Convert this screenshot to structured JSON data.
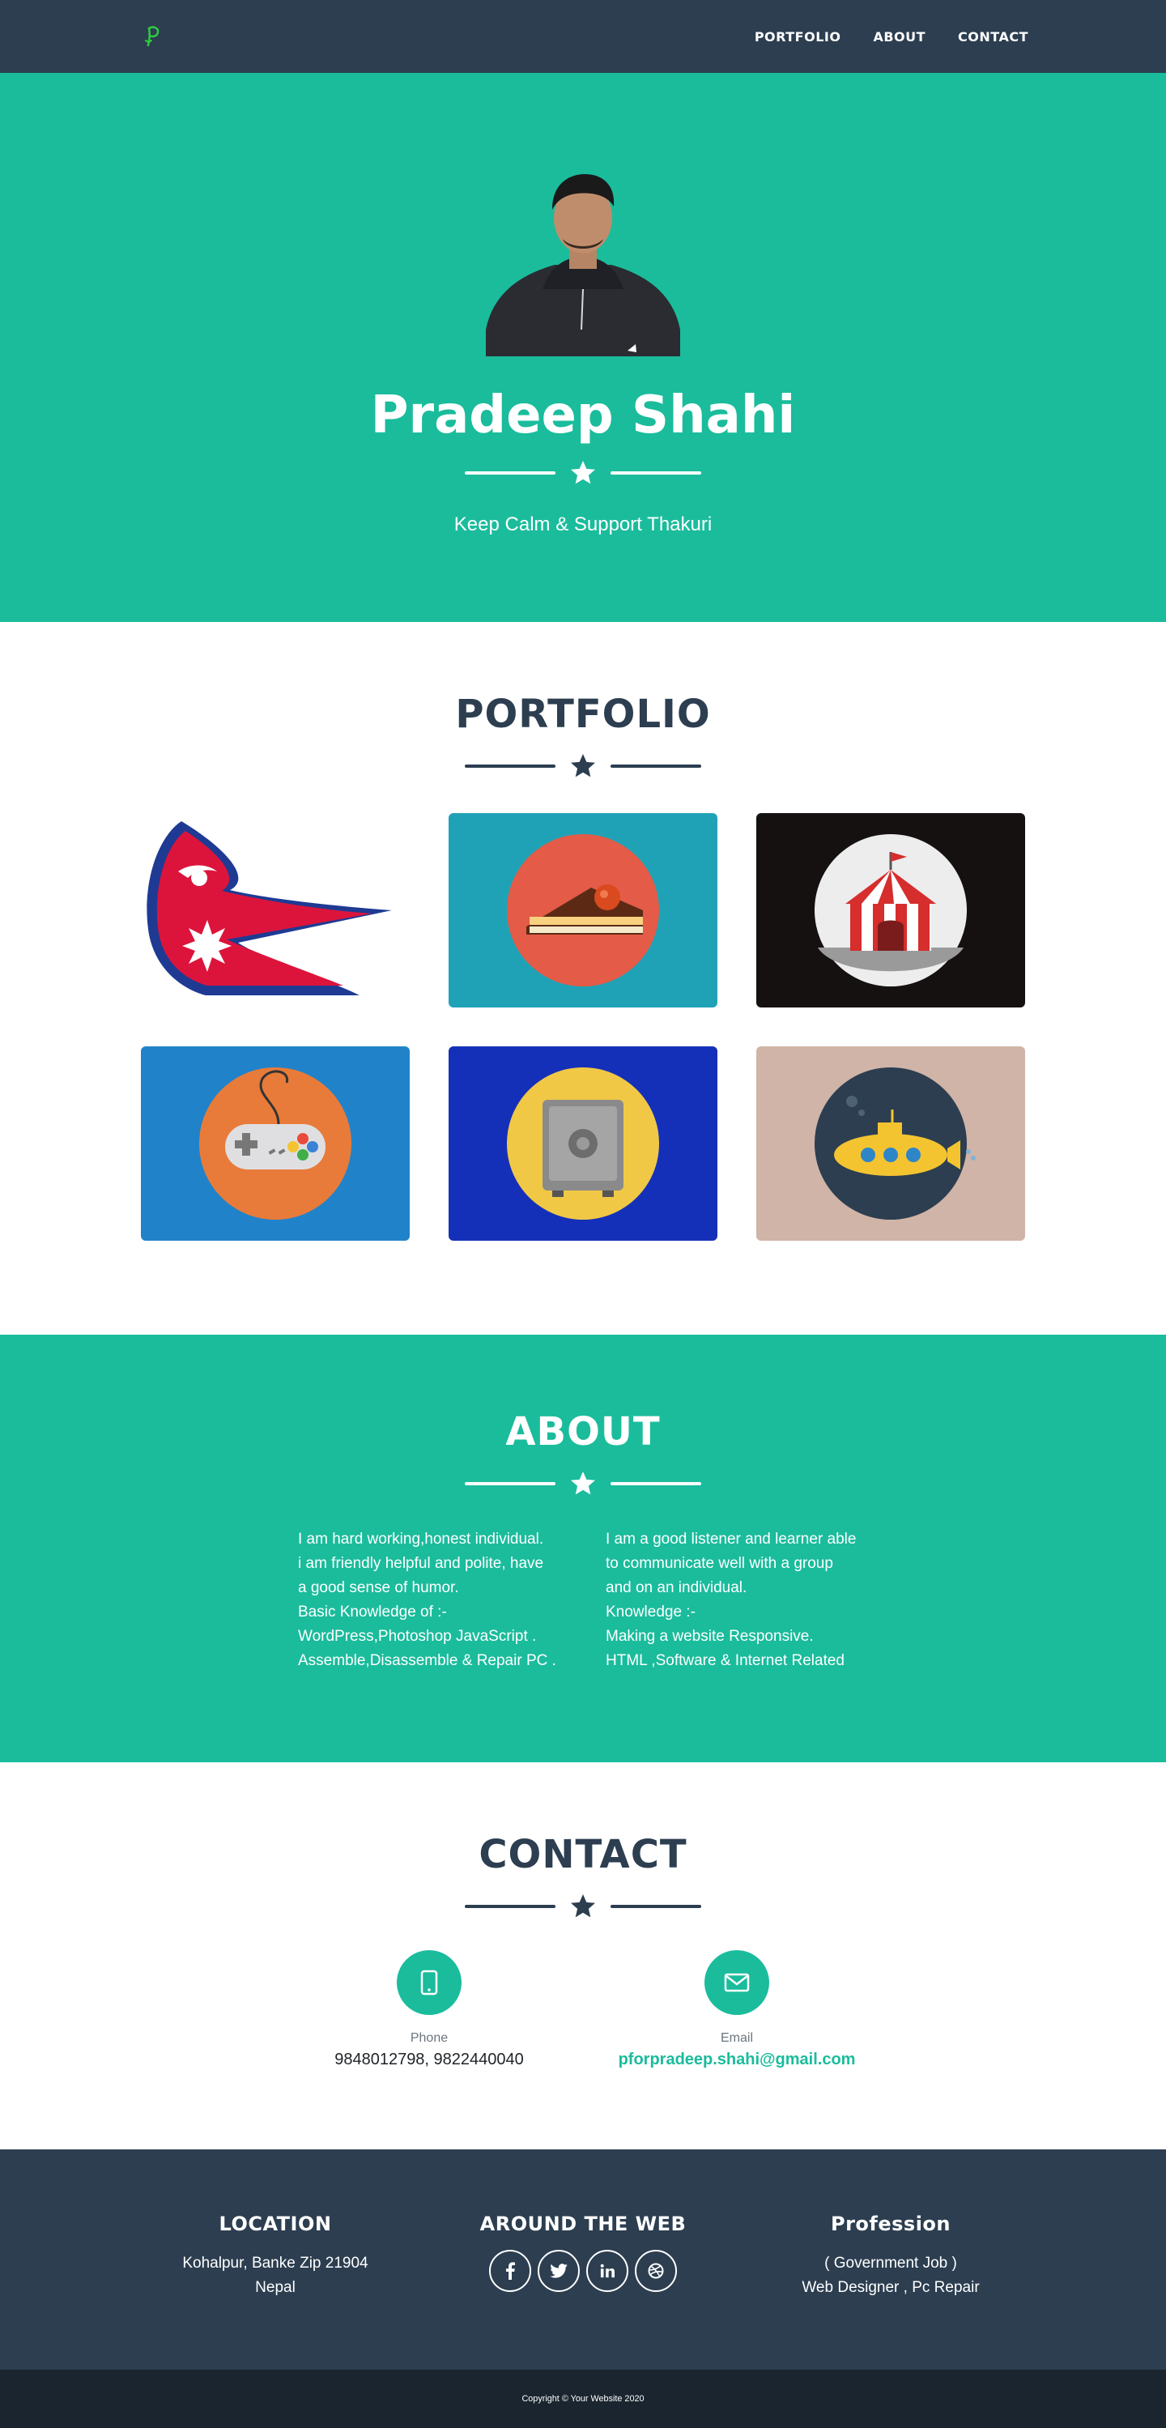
{
  "nav": {
    "brand_icon": "p-logo-icon",
    "links": [
      "PORTFOLIO",
      "ABOUT",
      "CONTACT"
    ]
  },
  "hero": {
    "name": "Pradeep Shahi",
    "tagline": "Keep Calm & Support Thakuri",
    "photo_icon": "profile-photo"
  },
  "portfolio": {
    "title": "PORTFOLIO",
    "items": [
      {
        "icon": "nepal-flag-icon",
        "bg": "#ffffff"
      },
      {
        "icon": "cake-icon",
        "bg": "#20a2b6"
      },
      {
        "icon": "circus-tent-icon",
        "bg": "#161111"
      },
      {
        "icon": "game-controller-icon",
        "bg": "#2083c9"
      },
      {
        "icon": "safe-icon",
        "bg": "#1530b8"
      },
      {
        "icon": "submarine-icon",
        "bg": "#cfb4a7"
      }
    ]
  },
  "about": {
    "title": "ABOUT",
    "left": [
      "I am hard working,honest individual.",
      "i am friendly helpful and polite, have",
      "a good sense of humor.",
      "Basic Knowledge of :-",
      "WordPress,Photoshop JavaScript .",
      "Assemble,Disassemble & Repair PC ."
    ],
    "right": [
      "I am a good listener and learner able",
      "to communicate well with a group",
      "and on an individual.",
      "Knowledge :-",
      "Making a website Responsive.",
      "HTML ,Software & Internet Related"
    ]
  },
  "contact": {
    "title": "CONTACT",
    "phone": {
      "label": "Phone",
      "value": "9848012798, 9822440040",
      "icon": "mobile-icon"
    },
    "email": {
      "label": "Email",
      "value": "pforpradeep.shahi@gmail.com",
      "icon": "envelope-icon"
    }
  },
  "footer": {
    "location": {
      "title": "LOCATION",
      "line1": "Kohalpur, Banke Zip 21904",
      "line2": "Nepal"
    },
    "web": {
      "title": "AROUND THE WEB",
      "social": [
        "facebook-icon",
        "twitter-icon",
        "linkedin-icon",
        "dribbble-icon"
      ]
    },
    "profession": {
      "title": "Profession",
      "line1": "( Government Job )",
      "line2": "Web Designer , Pc Repair"
    }
  },
  "copyright": "Copyright © Your Website 2020",
  "colors": {
    "primary": "#1abc9c",
    "dark": "#2c3e50",
    "darker": "#1a252f"
  }
}
